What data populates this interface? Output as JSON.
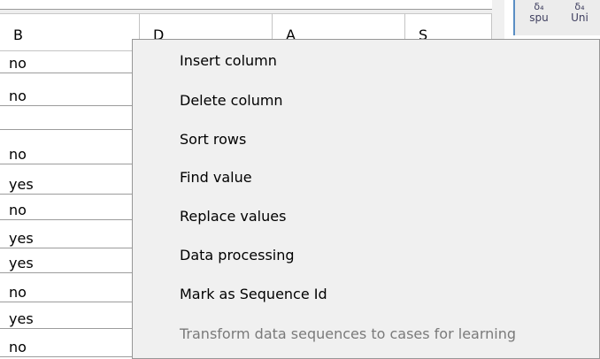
{
  "grid": {
    "headers": [
      "B",
      "D",
      "A",
      "S"
    ],
    "rows": [
      "no",
      "no",
      "",
      "no",
      "yes",
      "no",
      "yes",
      "yes",
      "no",
      "yes",
      "no"
    ]
  },
  "right_panel": {
    "columns": [
      {
        "symbol": "δ₄",
        "label": "spu"
      },
      {
        "symbol": "δ₄",
        "label": "Uni"
      }
    ]
  },
  "context_menu": {
    "items": [
      {
        "label": "Insert column",
        "enabled": true
      },
      {
        "label": "Delete column",
        "enabled": true
      },
      {
        "label": "Sort rows",
        "enabled": true
      },
      {
        "label": "Find value",
        "enabled": true
      },
      {
        "label": "Replace values",
        "enabled": true
      },
      {
        "label": "Data processing",
        "enabled": true
      },
      {
        "label": "Mark as Sequence Id",
        "enabled": true
      },
      {
        "label": "Transform data sequences to cases for learning",
        "enabled": false
      }
    ]
  }
}
